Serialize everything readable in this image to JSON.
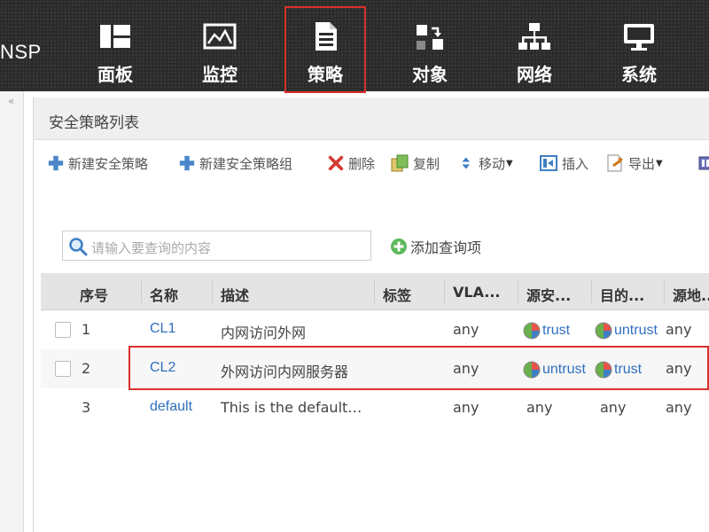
{
  "brand": "NSP",
  "nav": {
    "items": [
      {
        "label": "面板",
        "icon": "dashboard-icon"
      },
      {
        "label": "监控",
        "icon": "monitor-icon"
      },
      {
        "label": "策略",
        "icon": "policy-document-icon",
        "active": true
      },
      {
        "label": "对象",
        "icon": "objects-icon"
      },
      {
        "label": "网络",
        "icon": "network-icon"
      },
      {
        "label": "系统",
        "icon": "system-computer-icon"
      }
    ]
  },
  "panel": {
    "title": "安全策略列表"
  },
  "toolbar": {
    "new_policy": "新建安全策略",
    "new_policy_group": "新建安全策略组",
    "delete": "删除",
    "copy": "复制",
    "move": "移动",
    "insert": "插入",
    "export": "导出"
  },
  "search": {
    "placeholder": "请输入要查询的内容",
    "add_query": "添加查询项"
  },
  "table": {
    "headers": [
      "序号",
      "名称",
      "描述",
      "标签",
      "VLA...",
      "源安...",
      "目的...",
      "源地..."
    ],
    "rows": [
      {
        "index": "1",
        "name": "CL1",
        "description": "内网访问外网",
        "tag": "",
        "vlan": "any",
        "src_zone": "trust",
        "dst_zone": "untrust",
        "src_addr": "any"
      },
      {
        "index": "2",
        "name": "CL2",
        "description": "外网访问内网服务器",
        "tag": "",
        "vlan": "any",
        "src_zone": "untrust",
        "dst_zone": "trust",
        "src_addr": "any"
      },
      {
        "index": "3",
        "name": "default",
        "description": "This is the default…",
        "tag": "",
        "vlan": "any",
        "src_zone": "any",
        "dst_zone": "any",
        "src_addr": "any"
      }
    ]
  },
  "colors": {
    "accent_red": "#d9302a",
    "link_blue": "#2f6fbf",
    "topbar": "#2b2b2b"
  }
}
